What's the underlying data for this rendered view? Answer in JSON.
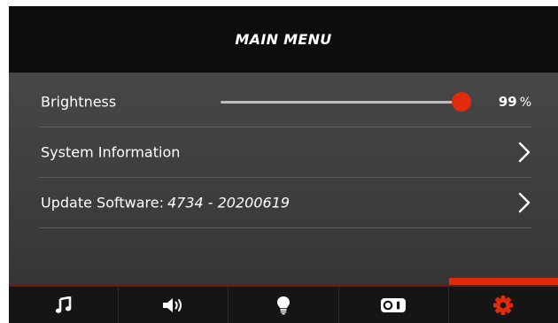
{
  "header": {
    "title": "MAIN MENU"
  },
  "menu": {
    "brightness": {
      "label": "Brightness",
      "value": "99",
      "unit": "%",
      "level": 0.99
    },
    "system_info": {
      "label": "System Information"
    },
    "update_software": {
      "label": "Update Software:",
      "version": "4734 - 20200619"
    }
  },
  "nav": {
    "tabs": [
      {
        "icon": "music-note-icon",
        "active": false
      },
      {
        "icon": "speaker-volume-icon",
        "active": false
      },
      {
        "icon": "light-bulb-icon",
        "active": false
      },
      {
        "icon": "toggle-switch-icon",
        "active": false
      },
      {
        "icon": "gear-icon",
        "active": true
      }
    ]
  },
  "colors": {
    "accent": "#e22a0c",
    "header_bg": "#0d0d0d",
    "panel_bg": "#3a3a3a",
    "text": "#ffffff"
  }
}
